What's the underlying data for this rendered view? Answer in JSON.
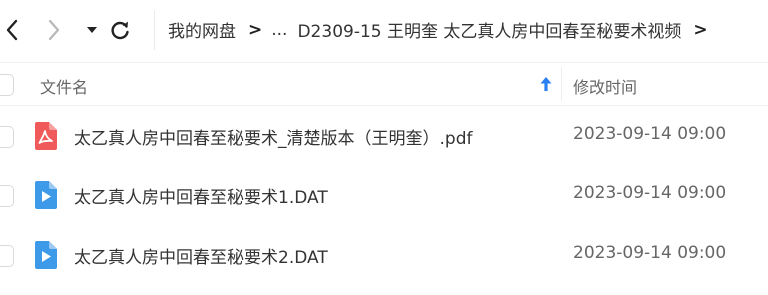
{
  "toolbar": {
    "back_icon": "chevron-left-icon",
    "forward_icon": "chevron-right-icon",
    "dropdown_icon": "caret-down-icon",
    "refresh_icon": "refresh-icon"
  },
  "breadcrumb": {
    "items": [
      {
        "label": "我的网盘"
      },
      {
        "label": "..."
      },
      {
        "label": "D2309-15 王明奎 太乙真人房中回春至秘要术视频"
      }
    ],
    "separator": ">"
  },
  "table": {
    "header": {
      "name": "文件名",
      "time": "修改时间",
      "sort_icon": "arrow-up-icon",
      "sort_color": "#2a7ff2"
    },
    "rows": [
      {
        "name": "太乙真人房中回春至秘要术_清楚版本（王明奎）.pdf",
        "time": "2023-09-14 09:00",
        "icon": "pdf-file-icon",
        "icon_color": "#f05a5a"
      },
      {
        "name": "太乙真人房中回春至秘要术1.DAT",
        "time": "2023-09-14 09:00",
        "icon": "video-file-icon",
        "icon_color": "#3d9ae8"
      },
      {
        "name": "太乙真人房中回春至秘要术2.DAT",
        "time": "2023-09-14 09:00",
        "icon": "video-file-icon",
        "icon_color": "#3d9ae8"
      }
    ]
  }
}
